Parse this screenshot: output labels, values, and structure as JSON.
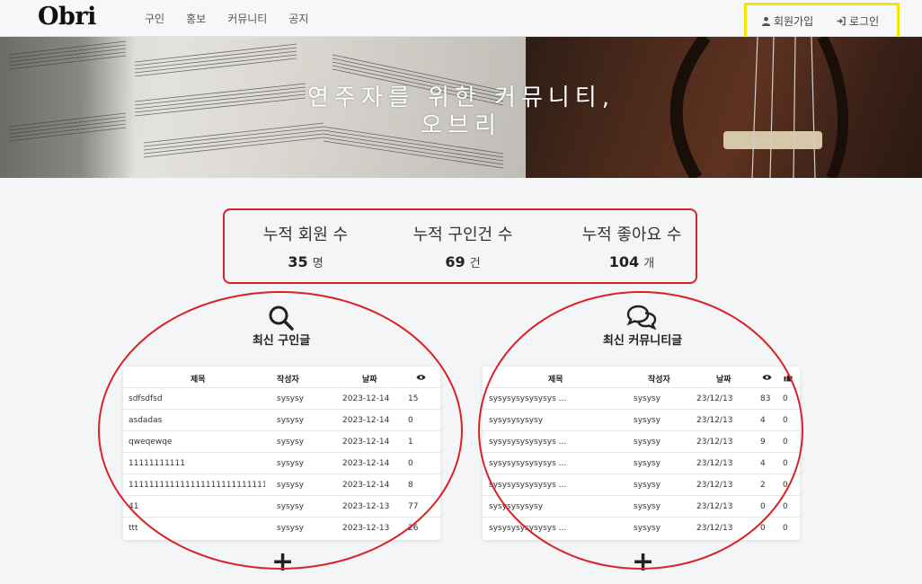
{
  "brand": {
    "logo": "Obri"
  },
  "nav": {
    "items": [
      "구인",
      "홍보",
      "커뮤니티",
      "공지"
    ]
  },
  "auth": {
    "signup": "회원가입",
    "login": "로그인"
  },
  "hero": {
    "line1": "연주자를 위한 커뮤니티,",
    "line2": "오브리"
  },
  "stats": [
    {
      "label": "누적 회원 수",
      "value": "35",
      "unit": "명"
    },
    {
      "label": "누적 구인건 수",
      "value": "69",
      "unit": "건"
    },
    {
      "label": "누적 좋아요 수",
      "value": "104",
      "unit": "개"
    }
  ],
  "recruit": {
    "title": "최신 구인글",
    "headers": {
      "title": "제목",
      "author": "작성자",
      "date": "날짜"
    },
    "rows": [
      {
        "title": "sdfsdfsd",
        "author": "sysysy",
        "date": "2023-12-14",
        "views": "15"
      },
      {
        "title": "asdadas",
        "author": "sysysy",
        "date": "2023-12-14",
        "views": "0"
      },
      {
        "title": "qweqewqe",
        "author": "sysysy",
        "date": "2023-12-14",
        "views": "1"
      },
      {
        "title": "11111111111",
        "author": "sysysy",
        "date": "2023-12-14",
        "views": "0"
      },
      {
        "title": "1111111111111111111111111111...",
        "author": "sysysy",
        "date": "2023-12-14",
        "views": "8"
      },
      {
        "title": "41",
        "author": "sysysy",
        "date": "2023-12-13",
        "views": "77"
      },
      {
        "title": "ttt",
        "author": "sysysy",
        "date": "2023-12-13",
        "views": "26"
      }
    ]
  },
  "community": {
    "title": "최신 커뮤니티글",
    "headers": {
      "title": "제목",
      "author": "작성자",
      "date": "날짜"
    },
    "rows": [
      {
        "title": "sysysysysysysys ...",
        "author": "sysysy",
        "date": "23/12/13",
        "views": "83",
        "likes": "0"
      },
      {
        "title": "sysysysysysy",
        "author": "sysysy",
        "date": "23/12/13",
        "views": "4",
        "likes": "0"
      },
      {
        "title": "sysysysysysysys ...",
        "author": "sysysy",
        "date": "23/12/13",
        "views": "9",
        "likes": "0"
      },
      {
        "title": "sysysysysysysys ...",
        "author": "sysysy",
        "date": "23/12/13",
        "views": "4",
        "likes": "0"
      },
      {
        "title": "sysysysysysysys ...",
        "author": "sysysy",
        "date": "23/12/13",
        "views": "2",
        "likes": "0"
      },
      {
        "title": "sysysysysysy",
        "author": "sysysy",
        "date": "23/12/13",
        "views": "0",
        "likes": "0"
      },
      {
        "title": "sysysysysysysys ...",
        "author": "sysysy",
        "date": "23/12/13",
        "views": "0",
        "likes": "0"
      }
    ]
  },
  "icons": {
    "views": "eye-icon",
    "likes": "thumbs-up-icon",
    "add": "plus-icon",
    "search": "search-icon",
    "chat": "chat-bubbles-icon"
  },
  "colors": {
    "annotation_red": "#d9222a",
    "annotation_yellow": "#f5e600"
  }
}
